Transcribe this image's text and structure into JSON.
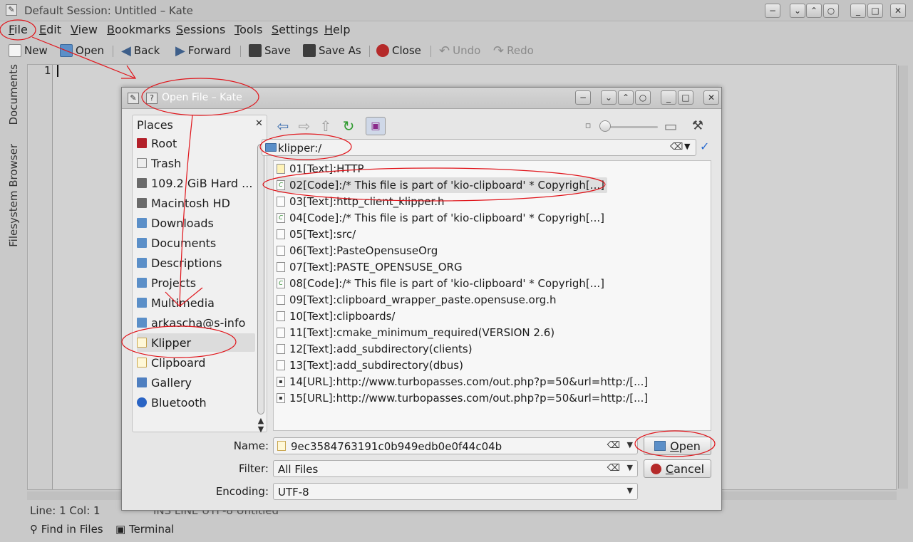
{
  "kate": {
    "title": "Default Session: Untitled – Kate",
    "menu": [
      "File",
      "Edit",
      "View",
      "Bookmarks",
      "Sessions",
      "Tools",
      "Settings",
      "Help"
    ],
    "toolbar": {
      "new": "New",
      "open": "Open",
      "back": "Back",
      "forward": "Forward",
      "save": "Save",
      "save_as": "Save As",
      "close": "Close",
      "undo": "Undo",
      "redo": "Redo"
    },
    "side_tabs": [
      "Documents",
      "Filesystem Browser"
    ],
    "editor": {
      "line_number": "1"
    },
    "status": {
      "position": "Line: 1 Col: 1",
      "mode": "INS  LINE  UTF-8  Untitled"
    },
    "bottom_tabs": [
      "Find in Files",
      "Terminal"
    ]
  },
  "dialog": {
    "title": "Open File – Kate",
    "places": {
      "header": "Places",
      "items": [
        "Root",
        "Trash",
        "109.2 GiB Hard ...",
        "Macintosh HD",
        "Downloads",
        "Documents",
        "Descriptions",
        "Projects",
        "Multimedia",
        "arkascha@s-info",
        "Klipper",
        "Clipboard",
        "Gallery",
        "Bluetooth"
      ],
      "selected": "Klipper"
    },
    "url": "klipper:/",
    "files": [
      "01[Text]:HTTP",
      "02[Code]:/* This file is part of 'kio-clipboard' * Copyrigh[...]",
      "03[Text]:http_client_klipper.h",
      "04[Code]:/* This file is part of 'kio-clipboard' * Copyrigh[...]",
      "05[Text]:src/",
      "06[Text]:PasteOpensuseOrg",
      "07[Text]:PASTE_OPENSUSE_ORG",
      "08[Code]:/* This file is part of 'kio-clipboard' * Copyrigh[...]",
      "09[Text]:clipboard_wrapper_paste.opensuse.org.h",
      "10[Text]:clipboards/",
      "11[Text]:cmake_minimum_required(VERSION 2.6)",
      "12[Text]:add_subdirectory(clients)",
      "13[Text]:add_subdirectory(dbus)",
      "14[URL]:http://www.turbopasses.com/out.php?p=50&url=http:/[...]",
      "15[URL]:http://www.turbopasses.com/out.php?p=50&url=http:/[...]"
    ],
    "name_label": "Name:",
    "name_value": "9ec3584763191c0b949edb0e0f44c04b",
    "filter_label": "Filter:",
    "filter_value": "All Files",
    "encoding_label": "Encoding:",
    "encoding_value": "UTF-8",
    "open_button": "Open",
    "cancel_button": "Cancel"
  },
  "colors": {
    "annotation": "#e0151b",
    "selection": "#dcdcdc",
    "folder": "#5b8fc8"
  }
}
